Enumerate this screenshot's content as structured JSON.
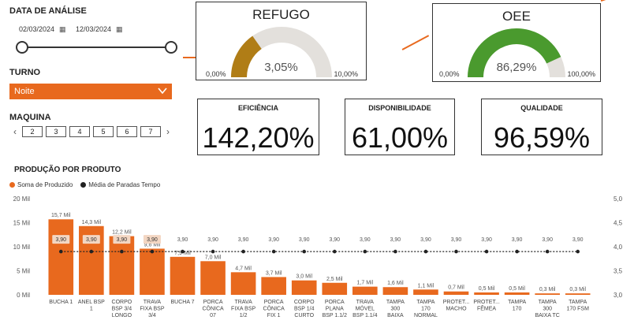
{
  "filters": {
    "date_label": "DATA DE ANÁLISE",
    "date_start": "02/03/2024",
    "date_end": "12/03/2024",
    "turno_label": "TURNO",
    "turno_value": "Noite",
    "maquina_label": "MAQUINA",
    "maquina_buttons": [
      "2",
      "3",
      "4",
      "5",
      "6",
      "7"
    ]
  },
  "refugo": {
    "title": "REFUGO",
    "value": "3,05%",
    "min": "0,00%",
    "max": "10,00%",
    "fraction": 0.305,
    "color": "#b07d16"
  },
  "oee": {
    "title": "OEE",
    "value": "86,29%",
    "min": "0,00%",
    "max": "100,00%",
    "fraction": 0.8629,
    "color": "#4a9a2e"
  },
  "kpis": {
    "eficiencia": {
      "title": "EFICIÊNCIA",
      "value": "142,20%"
    },
    "disponibilidade": {
      "title": "DISPONIBILIDADE",
      "value": "61,00%"
    },
    "qualidade": {
      "title": "QUALIDADE",
      "value": "96,59%"
    }
  },
  "chart_title": "PRODUÇÃO POR PRODUTO",
  "legend": {
    "series1": "Soma de Produzido",
    "series2": "Média de Paradas Tempo"
  },
  "colors": {
    "accent": "#e8691e",
    "line": "#222222"
  },
  "chart_data": {
    "type": "bar",
    "categories": [
      [
        "BUCHA 1"
      ],
      [
        "ANEL BSP",
        "1"
      ],
      [
        "CORPO",
        "BSP 3/4",
        "LONGO"
      ],
      [
        "TRAVA",
        "FIXA BSP",
        "3/4"
      ],
      [
        "BUCHA 7"
      ],
      [
        "PORCA",
        "CÔNICA",
        "07"
      ],
      [
        "TRAVA",
        "FIXA BSP",
        "1/2"
      ],
      [
        "PORCA",
        "CÔNICA",
        "FIX 1"
      ],
      [
        "CORPO",
        "BSP 1/4",
        "CURTO"
      ],
      [
        "PORCA",
        "PLANA",
        "BSP 1.1/2"
      ],
      [
        "TRAVA",
        "MÓVEL",
        "BSP 1.1/4"
      ],
      [
        "TAMPA",
        "300",
        "BAIXA"
      ],
      [
        "TAMPA",
        "170",
        "NORMAL"
      ],
      [
        "PROTET...",
        "MACHO"
      ],
      [
        "PROTET...",
        "FÊMEA"
      ],
      [
        "TAMPA",
        "170"
      ],
      [
        "TAMPA",
        "300",
        "BAIXA TC"
      ],
      [
        "TAMPA",
        "170 FSM"
      ]
    ],
    "series": [
      {
        "name": "Soma de Produzido",
        "values": [
          15.7,
          14.3,
          12.2,
          9.6,
          7.9,
          7.0,
          4.7,
          3.7,
          3.0,
          2.5,
          1.7,
          1.6,
          1.1,
          0.7,
          0.5,
          0.5,
          0.3,
          0.3
        ],
        "labels": [
          "15,7 Mil",
          "14,3 Mil",
          "12,2 Mil",
          "9,6 Mil",
          "7,9 Mil",
          "7,0 Mil",
          "4,7 Mil",
          "3,7 Mil",
          "3,0 Mil",
          "2,5 Mil",
          "1,7 Mil",
          "1,6 Mil",
          "1,1 Mil",
          "0,7 Mil",
          "0,5 Mil",
          "0,5 Mil",
          "0,3 Mil",
          "0,3 Mil"
        ]
      },
      {
        "name": "Média de Paradas Tempo",
        "values": [
          3.9,
          3.9,
          3.9,
          3.9,
          3.9,
          3.9,
          3.9,
          3.9,
          3.9,
          3.9,
          3.9,
          3.9,
          3.9,
          3.9,
          3.9,
          3.9,
          3.9,
          3.9
        ],
        "labels": [
          "3,90",
          "3,90",
          "3,90",
          "3,90",
          "3,90",
          "3,90",
          "3,90",
          "3,90",
          "3,90",
          "3,90",
          "3,90",
          "3,90",
          "3,90",
          "3,90",
          "3,90",
          "3,90",
          "3,90",
          "3,90"
        ]
      }
    ],
    "y_left_ticks": [
      "0 Mil",
      "5 Mil",
      "10 Mil",
      "15 Mil",
      "20 Mil"
    ],
    "ylim_left": [
      0,
      20
    ],
    "y_right_ticks": [
      "3,0",
      "3,5",
      "4,0",
      "4,5",
      "5,0"
    ],
    "ylim_right": [
      3.0,
      5.0
    ]
  }
}
